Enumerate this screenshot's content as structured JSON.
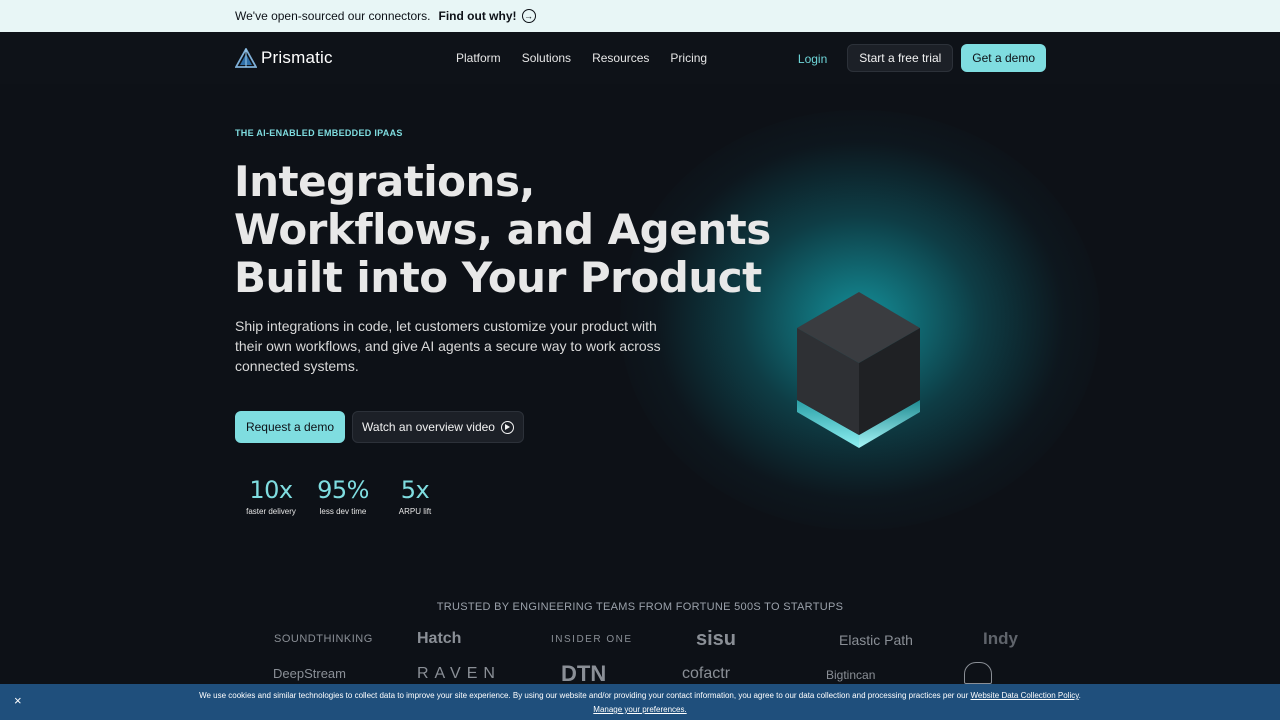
{
  "announcement": {
    "text": "We've open-sourced our connectors.",
    "link": "Find out why!"
  },
  "nav": {
    "brand": "Prismatic",
    "menu": [
      "Platform",
      "Solutions",
      "Resources",
      "Pricing"
    ],
    "login": "Login",
    "trial": "Start a free trial",
    "demo": "Get a demo"
  },
  "hero": {
    "eyebrow": "THE AI-ENABLED EMBEDDED IPAAS",
    "headline": [
      "Integrations,",
      "Workflows, and Agents",
      "Built into Your Product"
    ],
    "subtext": "Ship integrations in code, let customers customize your product with their own workflows, and give AI agents a secure way to work across connected systems.",
    "cta_primary": "Request a demo",
    "cta_secondary": "Watch an overview video",
    "stats": [
      {
        "value": "10x",
        "label": "faster delivery"
      },
      {
        "value": "95%",
        "label": "less dev time"
      },
      {
        "value": "5x",
        "label": "ARPU lift"
      }
    ]
  },
  "trusted": {
    "heading": "TRUSTED BY ENGINEERING TEAMS FROM FORTUNE 500S TO STARTUPS",
    "row1": [
      "SOUNDTHINKING",
      "Hatch",
      "INSIDER ONE",
      "sisu",
      "Elastic Path",
      "Indy"
    ],
    "row2": [
      "DeepStream",
      "RAVEN",
      "DTN",
      "cofactr",
      "Bigtincan",
      ""
    ]
  },
  "cookie": {
    "text": "We use cookies and similar technologies to collect data to improve your site experience. By using our website and/or providing your contact information, you agree to our data collection and processing practices per our",
    "policy": "Website Data Collection Policy",
    "prefs": "Manage your preferences.",
    "close": "×"
  },
  "colors": {
    "accent": "#7fdde0",
    "background": "#0d1117",
    "cookie_bar": "#1f4f7c"
  }
}
